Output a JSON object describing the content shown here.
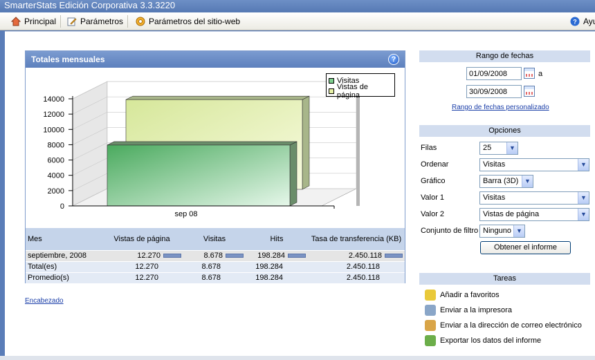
{
  "window": {
    "title": "SmarterStats Edición Corporativa 3.3.3220"
  },
  "toolbar": {
    "items": [
      {
        "label": "Principal",
        "icon": "home-icon"
      },
      {
        "label": "Parámetros",
        "icon": "edit-icon"
      },
      {
        "label": "Parámetros del sitio-web",
        "icon": "gear-icon"
      }
    ],
    "help_label": "Ayu"
  },
  "panel": {
    "title": "Totales mensuales",
    "help_icon": "help-icon"
  },
  "chart_data": {
    "type": "bar",
    "categories": [
      "sep 08"
    ],
    "series": [
      {
        "name": "Visitas",
        "values": [
          8678
        ],
        "color": "#7fcf8f"
      },
      {
        "name": "Vistas de página",
        "values": [
          12270
        ],
        "color": "#e6f0a6"
      }
    ],
    "y_ticks": [
      "14000",
      "12000",
      "10000",
      "8000",
      "6000",
      "4000",
      "2000",
      "0"
    ],
    "ylim": [
      0,
      14000
    ],
    "grid": true,
    "legend": "top-right",
    "three_d": true
  },
  "table": {
    "headers": [
      "Mes",
      "Vistas de página",
      "Visitas",
      "Hits",
      "Tasa de transferencia (KB)"
    ],
    "rows": [
      {
        "label": "septiembre, 2008",
        "values": [
          "12.270",
          "8.678",
          "198.284",
          "2.450.118"
        ],
        "bars": true
      },
      {
        "label": "Total(es)",
        "values": [
          "12.270",
          "8.678",
          "198.284",
          "2.450.118"
        ],
        "bars": false
      },
      {
        "label": "Promedio(s)",
        "values": [
          "12.270",
          "8.678",
          "198.284",
          "2.450.118"
        ],
        "bars": false
      }
    ]
  },
  "header_link": "Encabezado",
  "date_range": {
    "title": "Rango de fechas",
    "start": "01/09/2008",
    "connector": "a",
    "end": "30/09/2008",
    "custom_link": "Rango de fechas personalizado"
  },
  "options": {
    "title": "Opciones",
    "rows_label": "Filas",
    "rows_value": "25",
    "sort_label": "Ordenar",
    "sort_value": "Visitas",
    "chart_label": "Gráfico",
    "chart_value": "Barra (3D)",
    "value1_label": "Valor 1",
    "value1_value": "Visitas",
    "value2_label": "Valor 2",
    "value2_value": "Vistas de página",
    "filter_label": "Conjunto de filtro",
    "filter_value": "Ninguno",
    "submit_label": "Obtener el informe"
  },
  "tasks": {
    "title": "Tareas",
    "items": [
      {
        "label": "Añadir a favoritos",
        "icon": "favorites-icon",
        "color": "#e9c93a"
      },
      {
        "label": "Enviar a la impresora",
        "icon": "printer-icon",
        "color": "#8aa6c8"
      },
      {
        "label": "Enviar a la dirección de correo electrónico",
        "icon": "email-icon",
        "color": "#d9a548"
      },
      {
        "label": "Exportar los datos del informe",
        "icon": "export-icon",
        "color": "#6cae4a"
      }
    ]
  }
}
